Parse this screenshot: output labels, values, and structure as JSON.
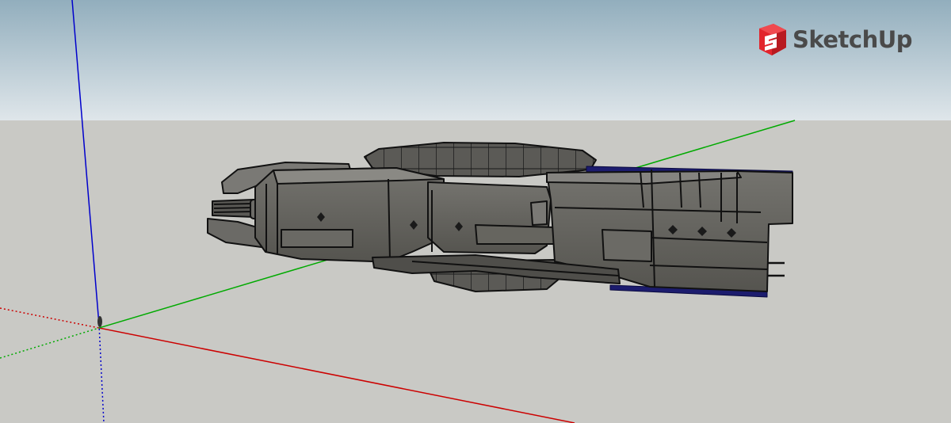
{
  "app": {
    "brand_name": "SketchUp",
    "brand_icon": "sketchup-logo-icon",
    "brand_color": "#e2252c"
  },
  "scene": {
    "sky_top_color": "#92aebd",
    "sky_horizon_color": "#dfe6ea",
    "ground_color": "#c9c9c5",
    "axes": {
      "red": "#cc0000",
      "green": "#00aa00",
      "blue": "#0000cc"
    },
    "model": "spaceship"
  }
}
